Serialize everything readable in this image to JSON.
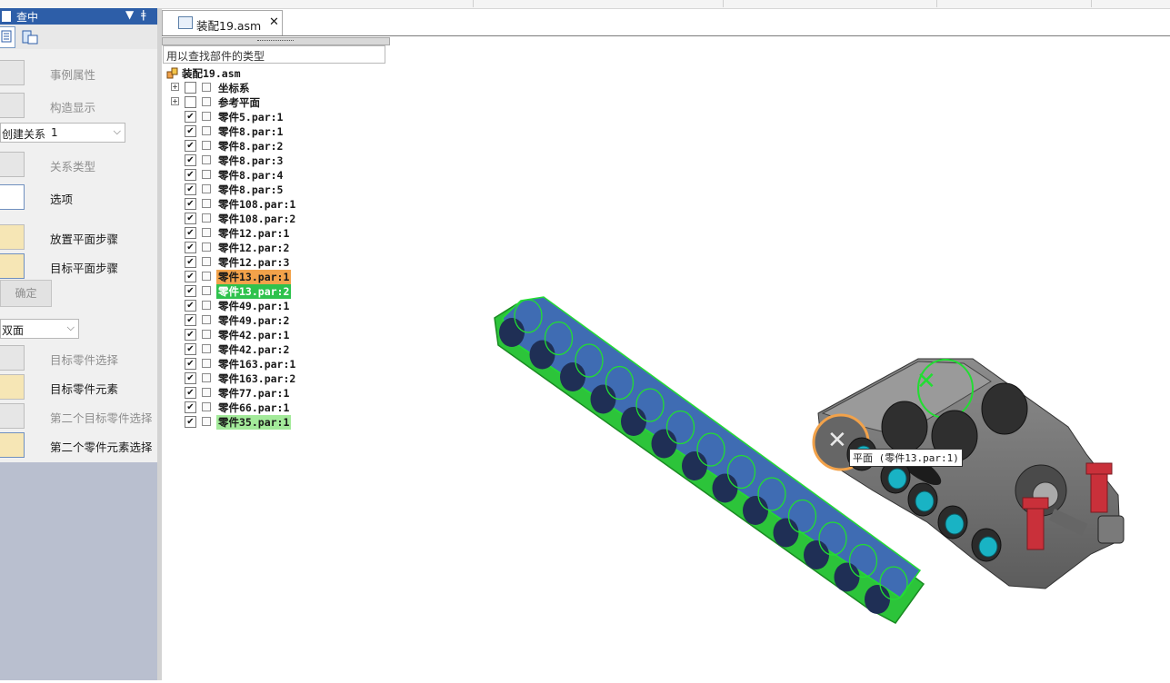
{
  "panel": {
    "title": "查中",
    "pin_glyph": "▼ ╤",
    "commands": [
      {
        "label": "事例属性",
        "enabled": false
      },
      {
        "label": "构造显示",
        "enabled": false
      },
      {
        "label": "关系类型",
        "enabled": false
      },
      {
        "label": "选项",
        "enabled": true
      },
      {
        "label": "放置平面步骤",
        "enabled": true
      },
      {
        "label": "目标平面步骤",
        "enabled": true
      },
      {
        "label": "目标零件选择",
        "enabled": false
      },
      {
        "label": "目标零件元素",
        "enabled": true
      },
      {
        "label": "第二个目标零件选择",
        "enabled": false
      },
      {
        "label": "第二个零件元素选择",
        "enabled": true
      }
    ],
    "relation_combo": {
      "label": "创建关系",
      "value": "1"
    },
    "ok_button": "确定",
    "side_combo": "双面"
  },
  "document_tab": {
    "title": "装配19.asm",
    "close_glyph": "✕"
  },
  "pathfinder": {
    "search_placeholder": "用以查找部件的类型",
    "root": "装配19.asm",
    "items": [
      {
        "name": "坐标系",
        "expandable": true,
        "checked": false
      },
      {
        "name": "参考平面",
        "expandable": true,
        "checked": false
      },
      {
        "name": "零件5.par:1",
        "checked": true
      },
      {
        "name": "零件8.par:1",
        "checked": true
      },
      {
        "name": "零件8.par:2",
        "checked": true
      },
      {
        "name": "零件8.par:3",
        "checked": true
      },
      {
        "name": "零件8.par:4",
        "checked": true
      },
      {
        "name": "零件8.par:5",
        "checked": true
      },
      {
        "name": "零件108.par:1",
        "checked": true
      },
      {
        "name": "零件108.par:2",
        "checked": true
      },
      {
        "name": "零件12.par:1",
        "checked": true
      },
      {
        "name": "零件12.par:2",
        "checked": true
      },
      {
        "name": "零件12.par:3",
        "checked": true
      },
      {
        "name": "零件13.par:1",
        "checked": true,
        "highlight": "orange"
      },
      {
        "name": "零件13.par:2",
        "checked": true,
        "highlight": "green"
      },
      {
        "name": "零件49.par:1",
        "checked": true
      },
      {
        "name": "零件49.par:2",
        "checked": true
      },
      {
        "name": "零件42.par:1",
        "checked": true
      },
      {
        "name": "零件42.par:2",
        "checked": true
      },
      {
        "name": "零件163.par:1",
        "checked": true
      },
      {
        "name": "零件163.par:2",
        "checked": true
      },
      {
        "name": "零件77.par:1",
        "checked": true
      },
      {
        "name": "零件66.par:1",
        "checked": true
      },
      {
        "name": "零件35.par:1",
        "checked": true,
        "highlight": "lightgreen"
      }
    ]
  },
  "viewport": {
    "tooltip": "平面 (零件13.par:1)"
  },
  "colors": {
    "panel_header": "#2d5ea8",
    "highlight_orange": "#f2a24a",
    "highlight_green": "#2ec24d",
    "highlight_lightgreen": "#a3ea9a",
    "beam_blue": "#3f6cb3",
    "select_green": "#22dd33"
  }
}
